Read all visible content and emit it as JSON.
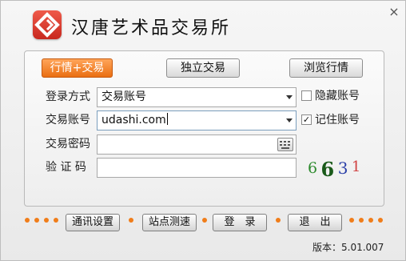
{
  "header": {
    "title": "汉唐艺术品交易所",
    "logo_icon": "diamond-logo-icon",
    "close_icon": "close-icon"
  },
  "tabs": [
    {
      "label": "行情+交易",
      "active": true
    },
    {
      "label": "独立交易",
      "active": false
    },
    {
      "label": "浏览行情",
      "active": false
    }
  ],
  "form": {
    "login_method_label": "登录方式",
    "login_method_value": "交易账号",
    "account_label": "交易账号",
    "account_value": "udashi.com",
    "password_label": "交易密码",
    "password_value": "",
    "captcha_label": "验 证 码",
    "captcha_value": "",
    "hide_account_label": "隐藏账号",
    "hide_account_checked": false,
    "remember_account_label": "记住账号",
    "remember_account_checked": true,
    "keyboard_icon": "keyboard-icon"
  },
  "captcha": {
    "chars": [
      "6",
      "6",
      "3",
      "1"
    ],
    "colors": [
      "#2e8b2e",
      "#1a5a1a",
      "#2a3fa8",
      "#d04040"
    ]
  },
  "bottom": {
    "comm_settings": "通讯设置",
    "speed_test": "站点测速",
    "login": "登　录",
    "exit": "退　出",
    "version": "版本：5.01.007"
  },
  "colors": {
    "accent_orange": "#f07d1a",
    "active_tab": "#ea6f12",
    "logo_red": "#d8352a"
  }
}
